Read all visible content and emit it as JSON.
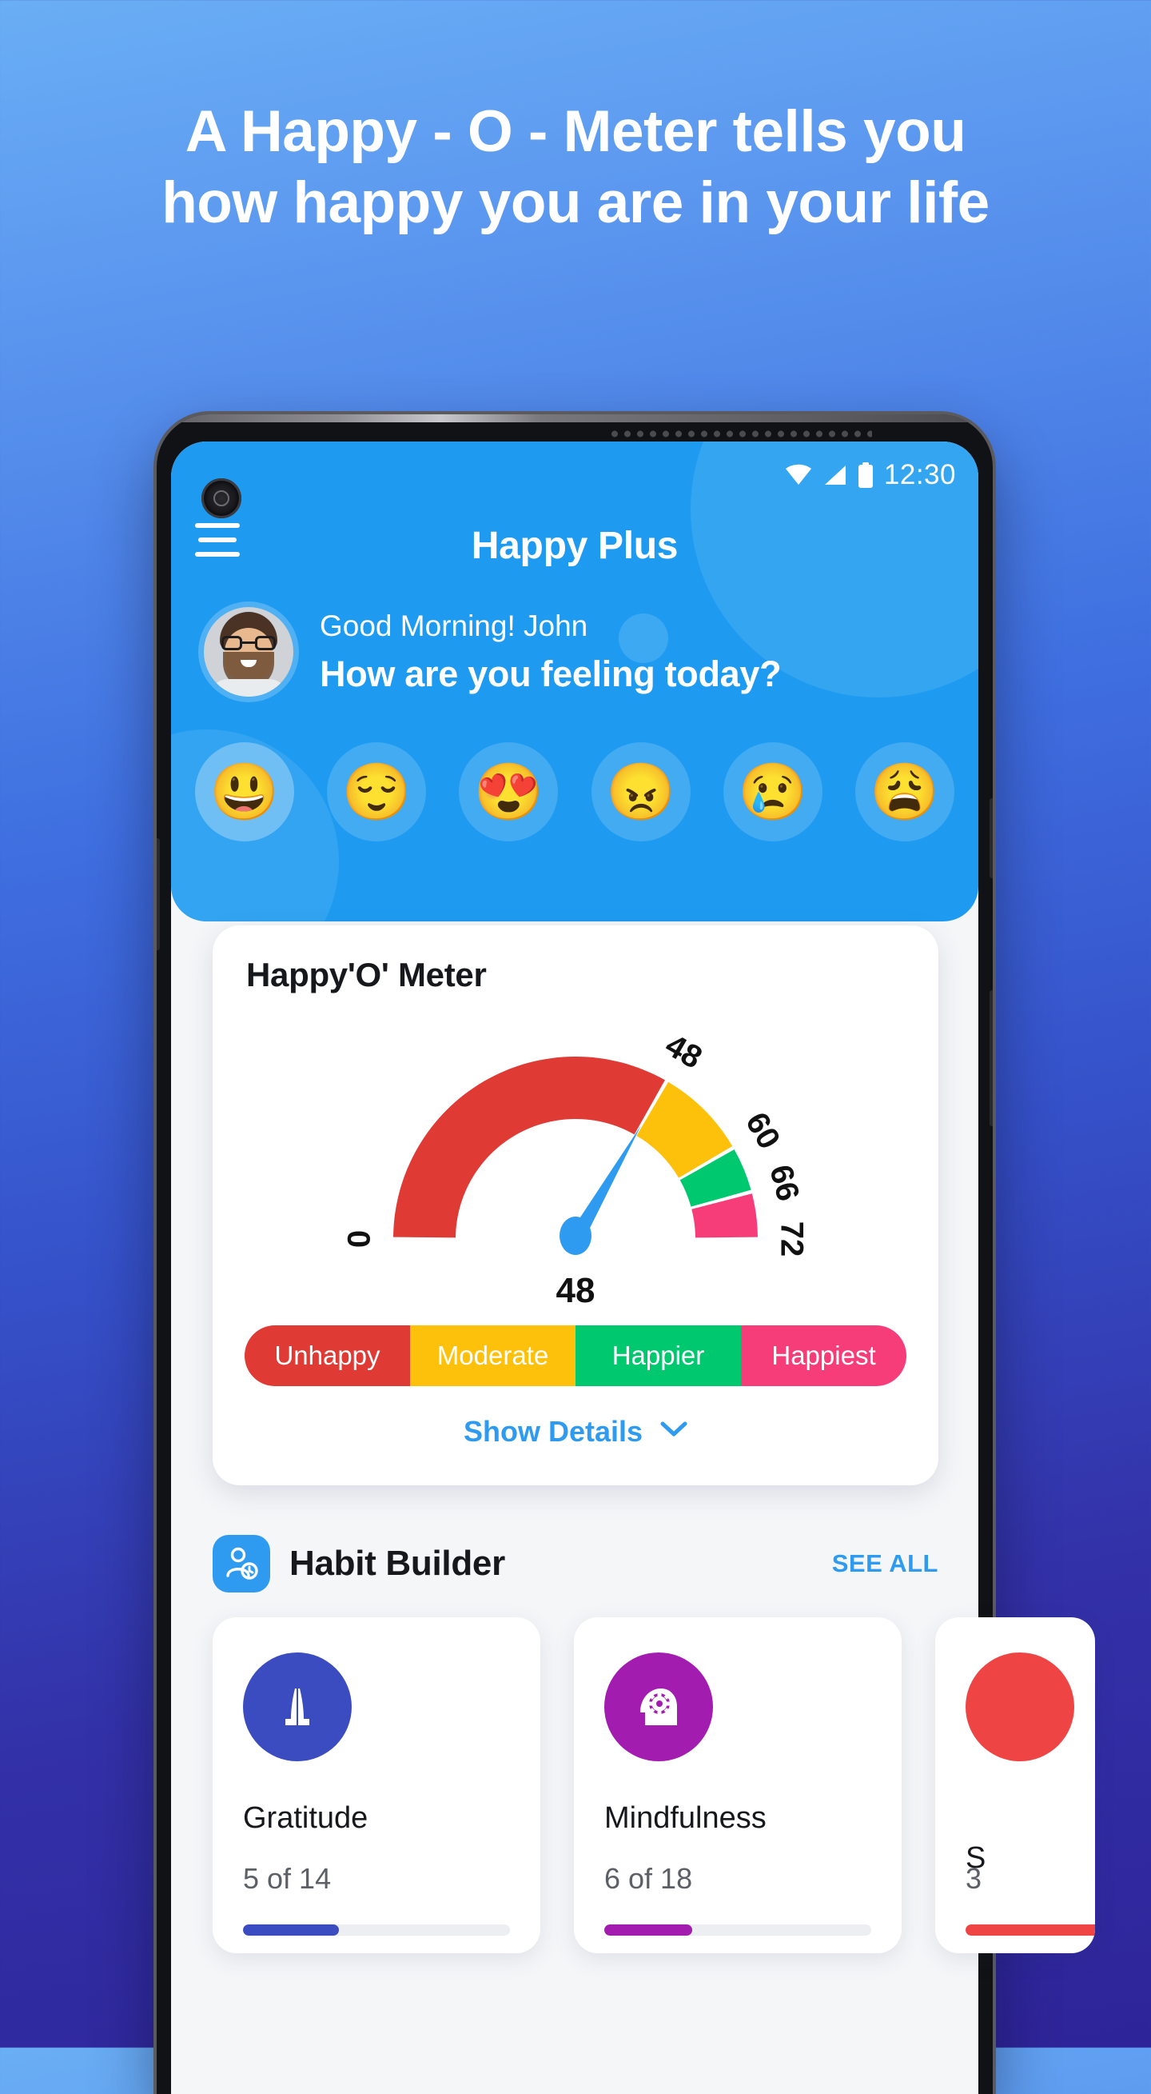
{
  "promo": {
    "line1": "A Happy - O - Meter tells you",
    "line2": "how happy you are in your life"
  },
  "status_bar": {
    "time": "12:30",
    "wifi_icon": "wifi-icon",
    "signal_icon": "signal-icon",
    "battery_icon": "battery-icon"
  },
  "app": {
    "title": "Happy Plus",
    "menu_icon": "hamburger-menu-icon"
  },
  "greeting": {
    "salutation": "Good Morning! John",
    "question": "How are you feeling today?",
    "avatar_name": "user-avatar"
  },
  "moods": [
    {
      "name": "grinning-face",
      "glyph": "😃",
      "selected": true
    },
    {
      "name": "relieved-face",
      "glyph": "😌",
      "selected": false
    },
    {
      "name": "heart-eyes-face",
      "glyph": "😍",
      "selected": false
    },
    {
      "name": "angry-face",
      "glyph": "😠",
      "selected": false
    },
    {
      "name": "crying-face",
      "glyph": "😢",
      "selected": false
    },
    {
      "name": "weary-sad-face",
      "glyph": "😩",
      "selected": false
    }
  ],
  "meter": {
    "title": "Happy'O' Meter",
    "value_label": "48",
    "show_details_label": "Show Details",
    "chevron_icon": "chevron-down-icon",
    "legend": [
      {
        "label": "Unhappy",
        "color": "#e03a35"
      },
      {
        "label": "Moderate",
        "color": "#fdc00b"
      },
      {
        "label": "Happier",
        "color": "#00c86f"
      },
      {
        "label": "Happiest",
        "color": "#f73d79"
      }
    ]
  },
  "chart_data": {
    "type": "gauge",
    "title": "Happy'O' Meter",
    "value": 48,
    "min": 0,
    "max": 72,
    "tick_labels": [
      "0",
      "48",
      "60",
      "66",
      "72"
    ],
    "tick_values": [
      0,
      48,
      60,
      66,
      72
    ],
    "needle_value": 48,
    "needle_color": "#2e9bf0",
    "center_label": "48",
    "bands": [
      {
        "label": "Unhappy",
        "from": 0,
        "to": 48,
        "color": "#e03a35"
      },
      {
        "label": "Moderate",
        "from": 48,
        "to": 60,
        "color": "#fdc00b"
      },
      {
        "label": "Happier",
        "from": 60,
        "to": 66,
        "color": "#00c86f"
      },
      {
        "label": "Happiest",
        "from": 66,
        "to": 72,
        "color": "#f73d79"
      }
    ],
    "start_angle_deg": 180,
    "end_angle_deg": 0,
    "grid": false,
    "legend_position": "bottom"
  },
  "habit_builder": {
    "section_title": "Habit Builder",
    "section_icon": "person-clock-icon",
    "see_all_label": "SEE ALL",
    "cards": [
      {
        "name": "Gratitude",
        "count": "5 of 14",
        "progress": 36,
        "color": "#3b4cc0",
        "icon": "praying-hands-icon"
      },
      {
        "name": "Mindfulness",
        "count": "6 of 18",
        "progress": 33,
        "color": "#a21caf",
        "icon": "head-gear-icon"
      },
      {
        "name": "S",
        "count": "3",
        "progress": 30,
        "color": "#ef4444",
        "icon": "partial-icon"
      }
    ]
  }
}
